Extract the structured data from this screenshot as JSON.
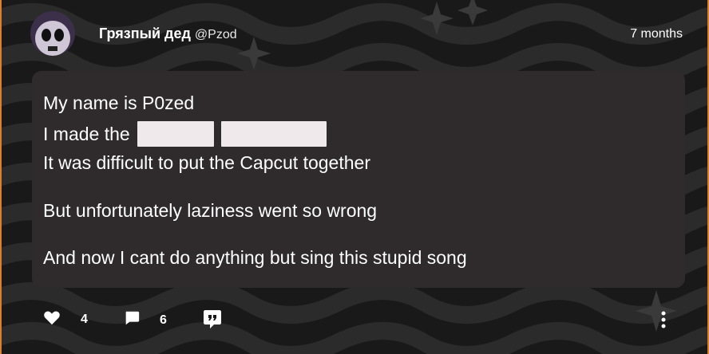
{
  "author": {
    "name": "Грязпый дед",
    "handle": "@Pzod"
  },
  "timestamp": "7 months",
  "message": {
    "line1": "My name is P0zed",
    "line2_prefix": "I made the",
    "line3": "It was difficult to put the Capcut together",
    "line4": "But unfortunately laziness went so wrong",
    "line5": "And now I cant do anything but sing this stupid song"
  },
  "actions": {
    "likes": "4",
    "comments": "6",
    "icons": [
      "heart-icon",
      "comment-icon",
      "quote-icon",
      "more-vertical-icon"
    ]
  },
  "colors": {
    "border": "#d9822b",
    "bubble": "#2f2b2d",
    "redaction": "#efe9ec",
    "background": "#191919",
    "wave": "#2a2a2a"
  }
}
